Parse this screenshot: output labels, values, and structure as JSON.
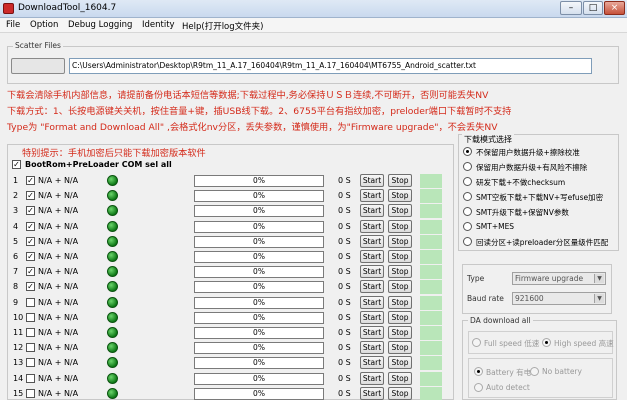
{
  "window": {
    "title": "DownloadTool_1604.7",
    "minimize": "–",
    "maximize": "□",
    "close": "×"
  },
  "menu": {
    "file": "File",
    "option": "Option",
    "debug": "Debug Logging",
    "identity": "Identity",
    "help": "Help(打开log文件夹)"
  },
  "scatter": {
    "group_label": "Scatter Files",
    "path": "C:\\Users\\Administrator\\Desktop\\R9tm_11_A.17_160404\\R9tm_11_A.17_160404\\MT6755_Android_scatter.txt"
  },
  "warnings": {
    "line1": "下载会清除手机内部信息，请提前备份电话本短信等数据;下载过程中,务必保持ＵＳＢ连续,不可断开，否则可能丢失NV",
    "line2": "下载方式：1、长按电源键关关机，按住音量+键，插USB线下载。2、6755平台有指纹加密，preloder端口下载暂时不支持",
    "line3": "Type为 \"Format and Download All\" ,会格式化nv分区，丢失参数，谨慎使用，为\"Firmware upgrade\"，不会丢失NV",
    "ports_hint": "特别提示：手机加密后只能下载加密版本软件"
  },
  "ports": {
    "bootrom_label": "BootRom+PreLoader COM sel all",
    "bootrom_checked": true,
    "rows": [
      {
        "num": "1",
        "checked": true,
        "port": "N/A + N/A",
        "progress": "0%",
        "secs": "0 S",
        "start": "Start",
        "stop": "Stop"
      },
      {
        "num": "2",
        "checked": true,
        "port": "N/A + N/A",
        "progress": "0%",
        "secs": "0 S",
        "start": "Start",
        "stop": "Stop"
      },
      {
        "num": "3",
        "checked": true,
        "port": "N/A + N/A",
        "progress": "0%",
        "secs": "0 S",
        "start": "Start",
        "stop": "Stop"
      },
      {
        "num": "4",
        "checked": true,
        "port": "N/A + N/A",
        "progress": "0%",
        "secs": "0 S",
        "start": "Start",
        "stop": "Stop"
      },
      {
        "num": "5",
        "checked": true,
        "port": "N/A + N/A",
        "progress": "0%",
        "secs": "0 S",
        "start": "Start",
        "stop": "Stop"
      },
      {
        "num": "6",
        "checked": true,
        "port": "N/A + N/A",
        "progress": "0%",
        "secs": "0 S",
        "start": "Start",
        "stop": "Stop"
      },
      {
        "num": "7",
        "checked": true,
        "port": "N/A + N/A",
        "progress": "0%",
        "secs": "0 S",
        "start": "Start",
        "stop": "Stop"
      },
      {
        "num": "8",
        "checked": true,
        "port": "N/A + N/A",
        "progress": "0%",
        "secs": "0 S",
        "start": "Start",
        "stop": "Stop"
      },
      {
        "num": "9",
        "checked": false,
        "port": "N/A + N/A",
        "progress": "0%",
        "secs": "0 S",
        "start": "Start",
        "stop": "Stop"
      },
      {
        "num": "10",
        "checked": false,
        "port": "N/A + N/A",
        "progress": "0%",
        "secs": "0 S",
        "start": "Start",
        "stop": "Stop"
      },
      {
        "num": "11",
        "checked": false,
        "port": "N/A + N/A",
        "progress": "0%",
        "secs": "0 S",
        "start": "Start",
        "stop": "Stop"
      },
      {
        "num": "12",
        "checked": false,
        "port": "N/A + N/A",
        "progress": "0%",
        "secs": "0 S",
        "start": "Start",
        "stop": "Stop"
      },
      {
        "num": "13",
        "checked": false,
        "port": "N/A + N/A",
        "progress": "0%",
        "secs": "0 S",
        "start": "Start",
        "stop": "Stop"
      },
      {
        "num": "14",
        "checked": false,
        "port": "N/A + N/A",
        "progress": "0%",
        "secs": "0 S",
        "start": "Start",
        "stop": "Stop"
      },
      {
        "num": "15",
        "checked": false,
        "port": "N/A + N/A",
        "progress": "0%",
        "secs": "0 S",
        "start": "Start",
        "stop": "Stop"
      }
    ]
  },
  "download_mode": {
    "title": "下载模式选择",
    "options": [
      {
        "label": "不保留用户数据升级+擦除校准",
        "selected": true
      },
      {
        "label": "保留用户数据升级+有风险不擦除",
        "selected": false
      },
      {
        "label": "研发下载+不做checksum",
        "selected": false
      },
      {
        "label": "SMT空板下载+下载NV+写efuse加密",
        "selected": false
      },
      {
        "label": "SMT升级下载+保留NV参数",
        "selected": false
      },
      {
        "label": "SMT+MES",
        "selected": false
      },
      {
        "label": "回读分区+读preloader分区量级件匹配",
        "selected": false
      }
    ]
  },
  "type_box": {
    "type_label": "Type",
    "type_value": "Firmware upgrade",
    "baud_label": "Baud rate",
    "baud_value": "921600"
  },
  "da": {
    "title": "DA download all",
    "full_speed": "Full speed 低速",
    "high_speed": "High speed 高速",
    "battery": "Battery 有电",
    "no_battery": "No battery",
    "auto_detect": "Auto detect"
  },
  "colors": {
    "warning_red": "#d42a1a",
    "led_green": "#1a9a22",
    "status_green": "#b9e6b9"
  }
}
